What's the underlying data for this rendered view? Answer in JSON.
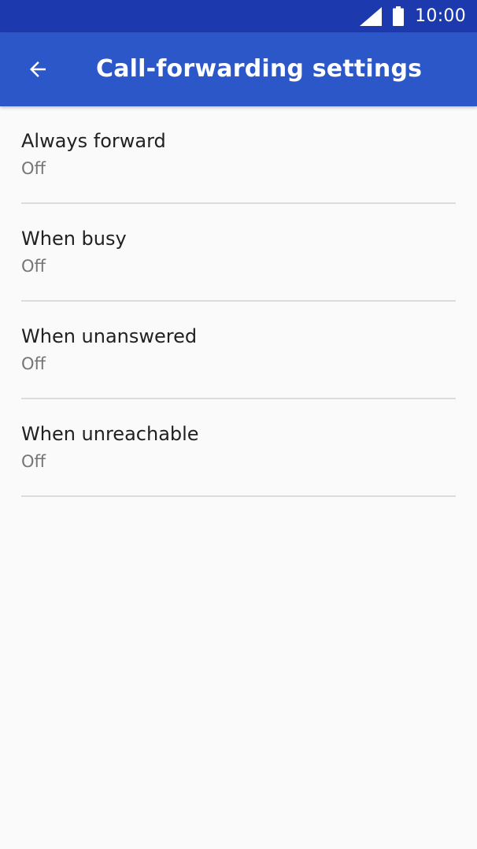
{
  "status_bar": {
    "time": "10:00",
    "icons": [
      "signal-icon",
      "battery-icon"
    ],
    "background": "#1c3aad"
  },
  "app_bar": {
    "title": "Call-forwarding settings",
    "back_icon": "arrow-back-icon",
    "background": "#2b57c9"
  },
  "settings": {
    "items": [
      {
        "title": "Always forward",
        "summary": "Off"
      },
      {
        "title": "When busy",
        "summary": "Off"
      },
      {
        "title": "When unanswered",
        "summary": "Off"
      },
      {
        "title": "When unreachable",
        "summary": "Off"
      }
    ]
  }
}
